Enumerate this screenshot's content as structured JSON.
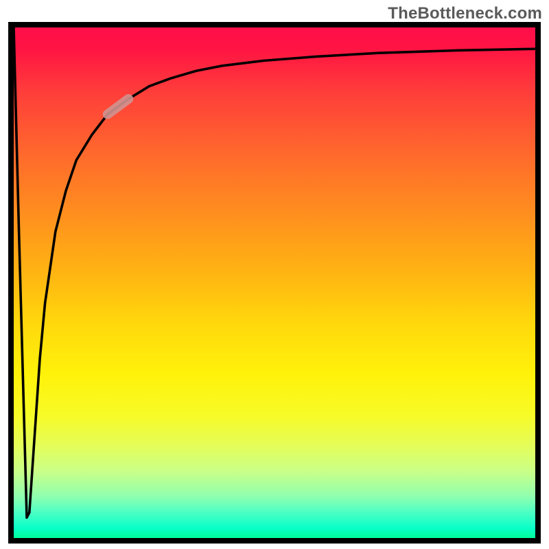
{
  "watermark": "TheBottleneck.com",
  "chart_data": {
    "type": "line",
    "title": "",
    "xlabel": "",
    "ylabel": "",
    "xlim": [
      0,
      100
    ],
    "ylim": [
      0,
      100
    ],
    "grid": false,
    "series": [
      {
        "name": "bottleneck-curve",
        "x": [
          0.0,
          1.0,
          2.5,
          3.0,
          4.0,
          5.0,
          6.0,
          8.0,
          10.0,
          12.0,
          15.0,
          18.0,
          22.0,
          26.0,
          30.0,
          35.0,
          40.0,
          48.0,
          58.0,
          70.0,
          85.0,
          100.0
        ],
        "values": [
          100,
          60,
          4,
          5,
          20,
          35,
          46,
          60,
          68,
          74,
          79,
          83,
          86,
          88.5,
          90,
          91.5,
          92.5,
          93.5,
          94.3,
          95,
          95.5,
          95.8
        ]
      },
      {
        "name": "highlight-segment",
        "x": [
          18.0,
          22.0
        ],
        "values": [
          83.0,
          86.0
        ]
      }
    ],
    "annotations": []
  },
  "colors": {
    "curve": "#000000",
    "highlight": "#d0928f",
    "frame": "#000000"
  }
}
